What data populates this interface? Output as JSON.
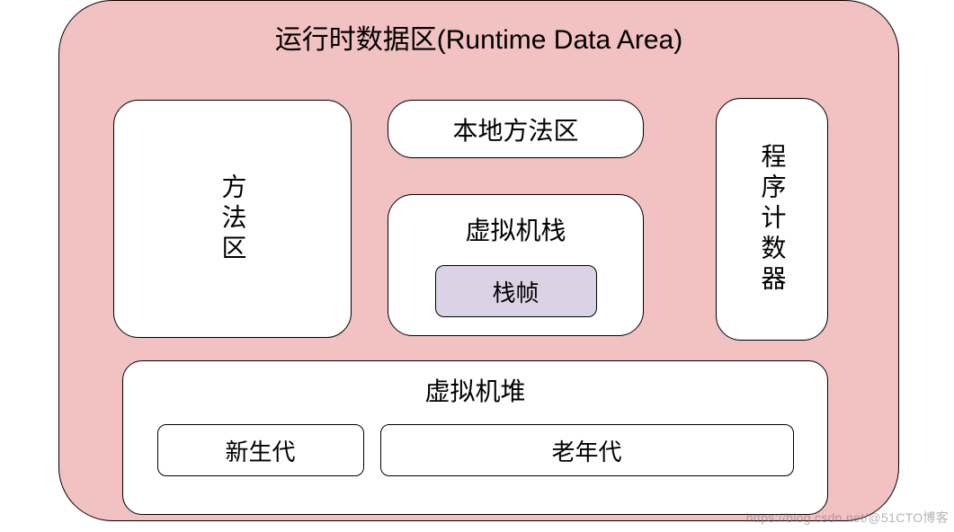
{
  "diagram": {
    "title": "运行时数据区(Runtime Data Area)",
    "method_area": "方法区",
    "native_method": "本地方法区",
    "vm_stack": {
      "label": "虚拟机栈",
      "stack_frame": "栈帧"
    },
    "pc_register": "程序计数器",
    "heap": {
      "label": "虚拟机堆",
      "young": "新生代",
      "old": "老年代"
    }
  },
  "watermark": "https://blog.csdn.net/@51CTO博客"
}
